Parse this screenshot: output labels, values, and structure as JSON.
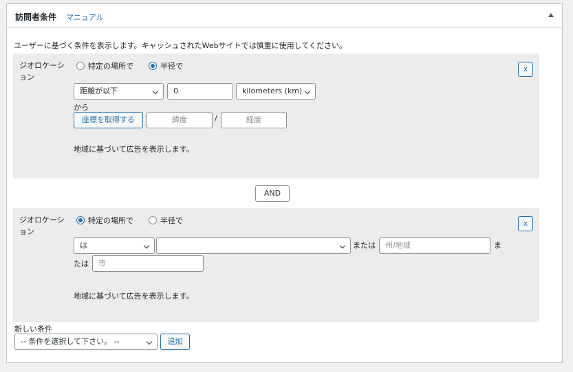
{
  "panel": {
    "title": "訪問者条件",
    "manual_link": "マニュアル",
    "description": "ユーザーに基づく条件を表示します。キャッシュされたWebサイトでは慎重に使用してください。"
  },
  "condition1": {
    "label": "ジオロケーション",
    "radio_specific": "特定の場所で",
    "radio_radius": "半径で",
    "selected": "radius",
    "distance_select": "距離が以下",
    "distance_value": "0",
    "unit_select": "kilometers (km)",
    "from_label": "から",
    "get_coords_button": "座標を取得する",
    "latitude_placeholder": "緯度",
    "separator": "/",
    "longitude_placeholder": "経度",
    "help": "地域に基づいて広告を表示します。",
    "close": "x"
  },
  "and_label": "AND",
  "condition2": {
    "label": "ジオロケーション",
    "radio_specific": "特定の場所で",
    "radio_radius": "半径で",
    "selected": "specific",
    "operator_select": "は",
    "country_select": "",
    "or_label_1": "または",
    "state_placeholder": "州/地域",
    "or_label_2a": "ま",
    "or_label_2b": "たは",
    "city_placeholder": "市",
    "help": "地域に基づいて広告を表示します。",
    "close": "x"
  },
  "new_condition": {
    "label": "新しい条件",
    "select": "-- 条件を選択して下さい。 --",
    "add_button": "追加"
  }
}
